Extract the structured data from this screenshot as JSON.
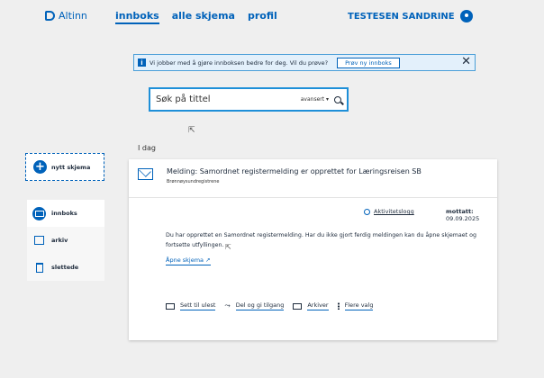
{
  "header": {
    "logo": "Altinn",
    "nav": [
      "innboks",
      "alle skjema",
      "profil"
    ],
    "user": "TESTESEN SANDRINE"
  },
  "banner": {
    "info_icon": "i",
    "text": "Vi jobber med å gjøre innboksen bedre for deg. Vil du prøve?",
    "button": "Prøv ny innboks",
    "close": "✕"
  },
  "search": {
    "placeholder": "Søk på tittel",
    "advanced": "avansert ▾"
  },
  "section": {
    "today": "I dag"
  },
  "sidebar": {
    "new_label": "nytt skjema",
    "items": [
      {
        "label": "innboks",
        "icon": "envelope-icon"
      },
      {
        "label": "arkiv",
        "icon": "archive-icon"
      },
      {
        "label": "slettede",
        "icon": "trash-icon"
      }
    ]
  },
  "message": {
    "title": "Melding: Samordnet registermelding er opprettet for Læringsreisen SB",
    "sender": "Brønnøysundregistrene",
    "activity_log": "Aktivitetslogg",
    "received_label": "mottatt:",
    "received_date": "09.09.2025",
    "body": "Du har opprettet en Samordnet registermelding. Har du ikke gjort ferdig meldingen kan du åpne skjemaet og fortsette utfyllingen.",
    "open_link": "Åpne skjema ↗",
    "actions": [
      "Sett til ulest",
      "Del og gi tilgang",
      "Arkiver",
      "Flere valg"
    ]
  },
  "colors": {
    "accent": "#0062ba",
    "banner_bg": "#e3f0fb"
  }
}
